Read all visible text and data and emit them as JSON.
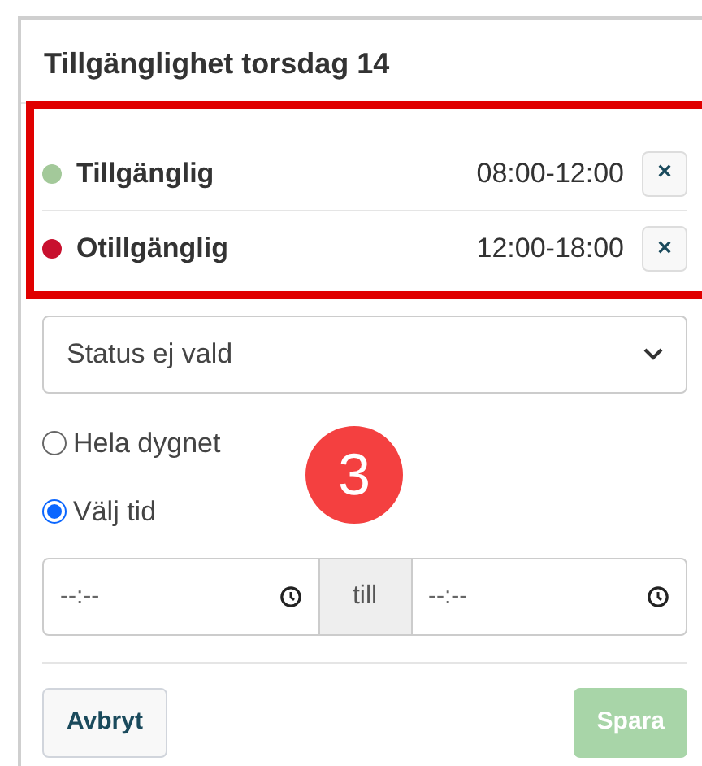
{
  "title": "Tillgänglighet torsdag 14",
  "entries": [
    {
      "status": "Tillgänglig",
      "time": "08:00-12:00",
      "color": "#a3c99a",
      "remove": "×"
    },
    {
      "status": "Otillgänglig",
      "time": "12:00-18:00",
      "color": "#c8102e",
      "remove": "×"
    }
  ],
  "status_select": {
    "value": "Status ej vald"
  },
  "time_mode": [
    {
      "label": "Hela dygnet",
      "selected": false
    },
    {
      "label": "Välj tid",
      "selected": true
    }
  ],
  "time_range": {
    "from_placeholder": "--:--",
    "separator": "till",
    "to_placeholder": "--:--"
  },
  "step_badge": "3",
  "buttons": {
    "cancel": {
      "label": "Avbryt",
      "disabled": false
    },
    "save": {
      "label": "Spara",
      "disabled": true
    }
  }
}
